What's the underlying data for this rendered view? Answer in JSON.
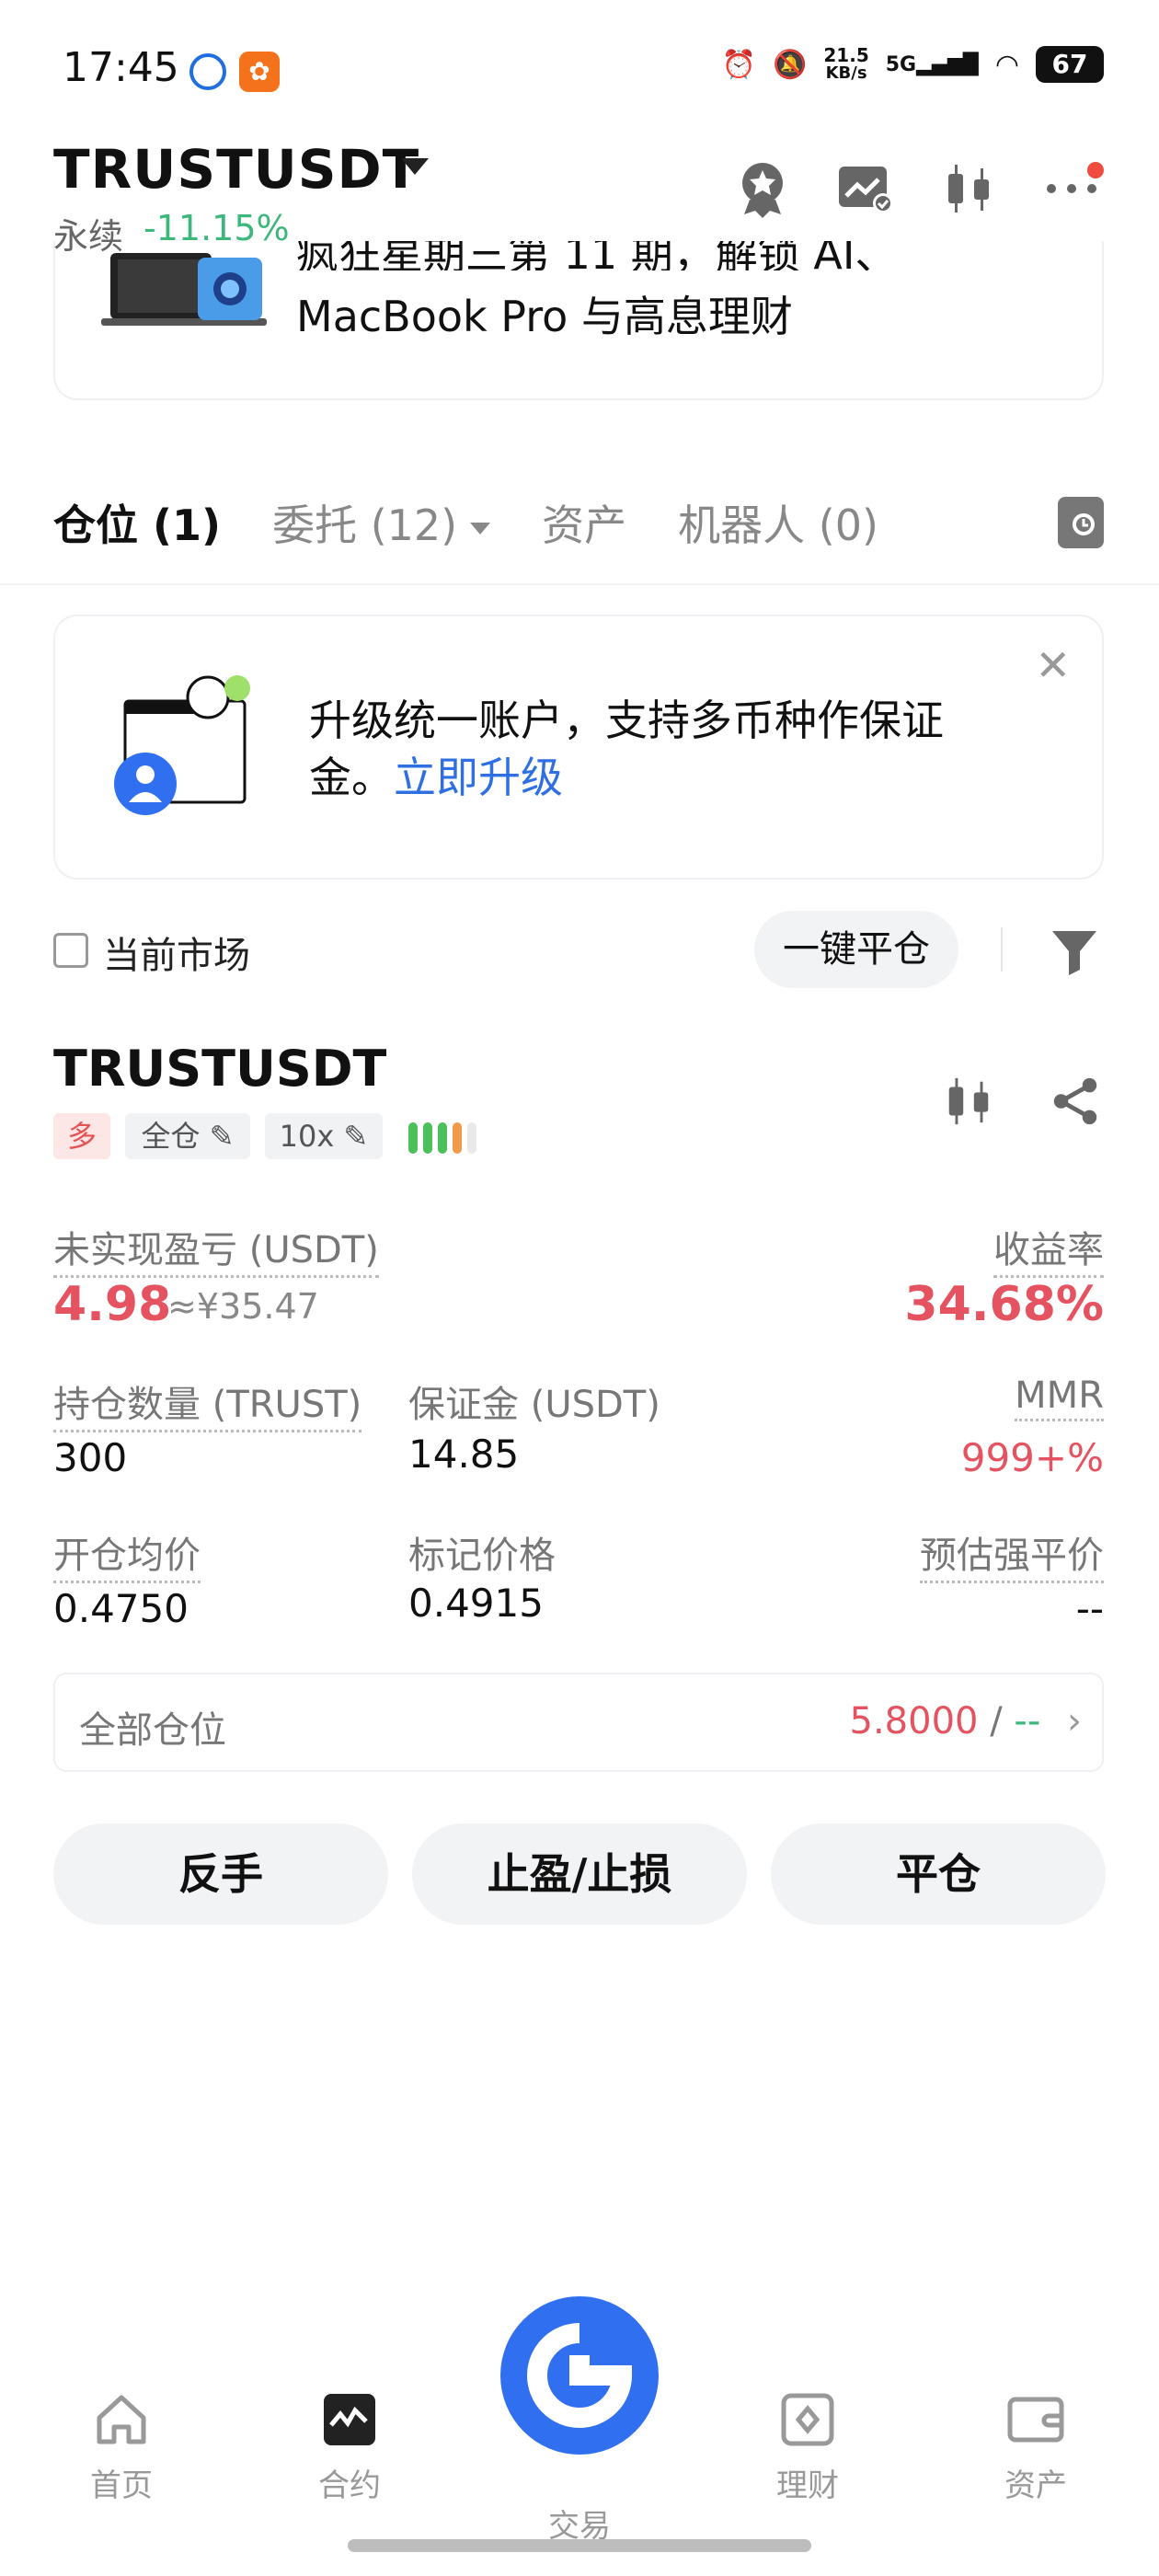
{
  "status_bar": {
    "time": "17:45",
    "net_speed_value": "21.5",
    "net_speed_unit": "KB/s",
    "signal": "5G",
    "battery": "67"
  },
  "header": {
    "pair": "TRUSTUSDT",
    "contract_type": "永续",
    "change": "-11.15%"
  },
  "banner": {
    "line1": "疯狂星期三第 11 期，解锁 AI、",
    "line2": "MacBook Pro 与高息理财"
  },
  "tabs": [
    {
      "label": "仓位 (1)"
    },
    {
      "label": "委托 (12)"
    },
    {
      "label": "资产"
    },
    {
      "label": "机器人 (0)"
    }
  ],
  "upgrade": {
    "text": "升级统一账户，支持多币种作保证金。",
    "link": "立即升级"
  },
  "filter": {
    "current_market_label": "当前市场",
    "close_all_label": "一键平仓"
  },
  "position": {
    "symbol": "TRUSTUSDT",
    "side": "多",
    "margin_mode": "全仓",
    "leverage": "10x",
    "risk_level": 4,
    "unrealized_pnl_label": "未实现盈亏 (USDT)",
    "unrealized_pnl": "4.98",
    "unrealized_pnl_cny": "≈¥35.47",
    "roe_label": "收益率",
    "roe": "34.68%",
    "size_label": "持仓数量 (TRUST)",
    "size": "300",
    "margin_label": "保证金 (USDT)",
    "margin": "14.85",
    "mmr_label": "MMR",
    "mmr": "999+%",
    "entry_label": "开仓均价",
    "entry": "0.4750",
    "mark_label": "标记价格",
    "mark": "0.4915",
    "liq_label": "预估强平价",
    "liq": "--",
    "all_positions_label": "全部仓位",
    "all_positions_value": "5.8000",
    "all_positions_sep": "/",
    "all_positions_other": "--"
  },
  "actions": {
    "reverse": "反手",
    "tpsl": "止盈/止损",
    "close": "平仓"
  },
  "bottom_nav": [
    {
      "label": "首页"
    },
    {
      "label": "合约"
    },
    {
      "label": "交易"
    },
    {
      "label": "理财"
    },
    {
      "label": "资产"
    }
  ],
  "colors": {
    "accent_blue": "#2f6ff0",
    "profit_red": "#e55360",
    "change_green": "#3cb87a"
  }
}
